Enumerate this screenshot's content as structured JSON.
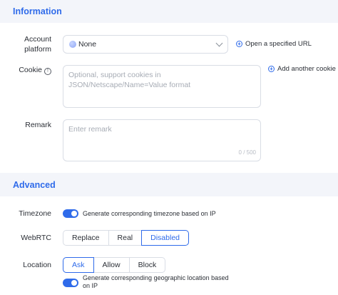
{
  "info_section": {
    "title": "Information"
  },
  "account": {
    "label_line1": "Account",
    "label_line2": "platform",
    "value": "None",
    "open_url_link": "Open a specified URL"
  },
  "cookie": {
    "label": "Cookie",
    "placeholder": "Optional, support cookies in JSON/Netscape/Name=Value format",
    "add_another": "Add another cookie"
  },
  "remark": {
    "label": "Remark",
    "placeholder": "Enter remark",
    "counter": "0 / 500"
  },
  "advanced_section": {
    "title": "Advanced"
  },
  "timezone": {
    "label": "Timezone",
    "toggle_on": true,
    "toggle_text": "Generate corresponding timezone based on IP"
  },
  "webrtc": {
    "label": "WebRTC",
    "options": [
      "Replace",
      "Real",
      "Disabled"
    ],
    "selected": "Disabled"
  },
  "location": {
    "label": "Location",
    "options": [
      "Ask",
      "Allow",
      "Block"
    ],
    "selected": "Ask",
    "toggle_on": true,
    "toggle_text_line1": "Generate corresponding geographic location based",
    "toggle_text_line2": "on IP"
  },
  "colors": {
    "accent": "#2f6bea",
    "header_bg": "#f3f5fa",
    "border": "#d9dde5"
  }
}
